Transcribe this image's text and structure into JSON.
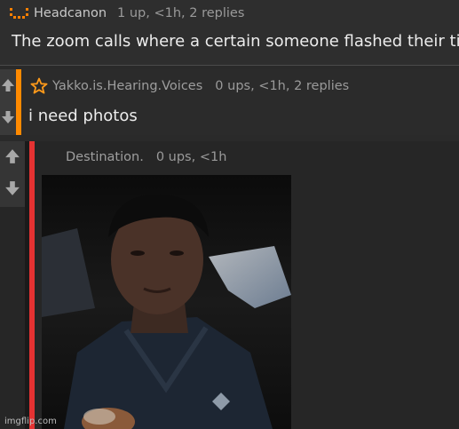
{
  "comment_1": {
    "username": "Headcanon",
    "stats": "1 up, <1h, 2 replies",
    "text": "The zoom calls where a certain someone flashed their tits"
  },
  "comment_2": {
    "username": "Yakko.is.Hearing.Voices",
    "stats": "0 ups, <1h, 2 replies",
    "text": "i need photos",
    "thread_color": "#ff8a00"
  },
  "comment_3": {
    "username": "Destination.",
    "stats": "0 ups, <1h",
    "thread_color": "#e53232"
  },
  "watermark": "imgflip.com",
  "icons": {
    "upvote": "up-arrow-icon",
    "downvote": "down-arrow-icon",
    "avatar": "pixel-face-icon",
    "badge": "star-outline-icon"
  }
}
